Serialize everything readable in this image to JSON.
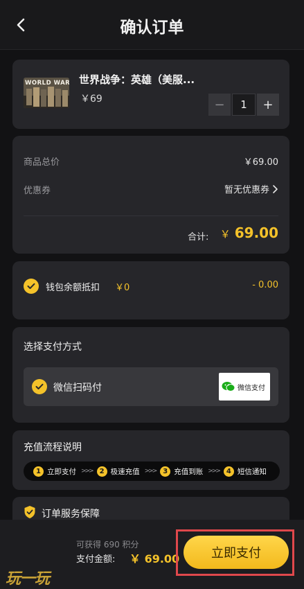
{
  "header": {
    "title": "确认订单",
    "back_icon": "chevron-left-icon"
  },
  "product": {
    "thumb_text": "WORLD WAR",
    "name": "世界战争：英雄（美服...",
    "price": "￥69",
    "quantity": "1",
    "minus_label": "−",
    "plus_label": "+"
  },
  "pricing": {
    "subtotal_label": "商品总价",
    "subtotal_value": "￥69.00",
    "coupon_label": "优惠券",
    "coupon_value": "暂无优惠券",
    "total_label": "合计:",
    "total_currency": "￥",
    "total_value": "69.00"
  },
  "wallet": {
    "label": "钱包余额抵扣",
    "balance": "￥0",
    "deduction": "- 0.00",
    "checked": true
  },
  "payment": {
    "section_title": "选择支付方式",
    "option_label": "微信扫码付",
    "badge_text": "微信支付",
    "checked": true
  },
  "flow": {
    "section_title": "充值流程说明",
    "steps": [
      {
        "num": "1",
        "label": "立即支付"
      },
      {
        "num": "2",
        "label": "极速充值"
      },
      {
        "num": "3",
        "label": "充值到账"
      },
      {
        "num": "4",
        "label": "短信通知"
      }
    ],
    "arrow": ">>>"
  },
  "service": {
    "title": "订单服务保障"
  },
  "bottom": {
    "points_text": "可获得 690 积分",
    "amount_label": "支付金额:",
    "amount_value": "￥ 69.00",
    "pay_button": "立即支付"
  },
  "watermark": "玩一玩",
  "colors": {
    "accent": "#f4c22a",
    "background": "#121214",
    "card": "#26262a",
    "highlight_border": "#e0484c",
    "wechat_green": "#1aad19"
  }
}
